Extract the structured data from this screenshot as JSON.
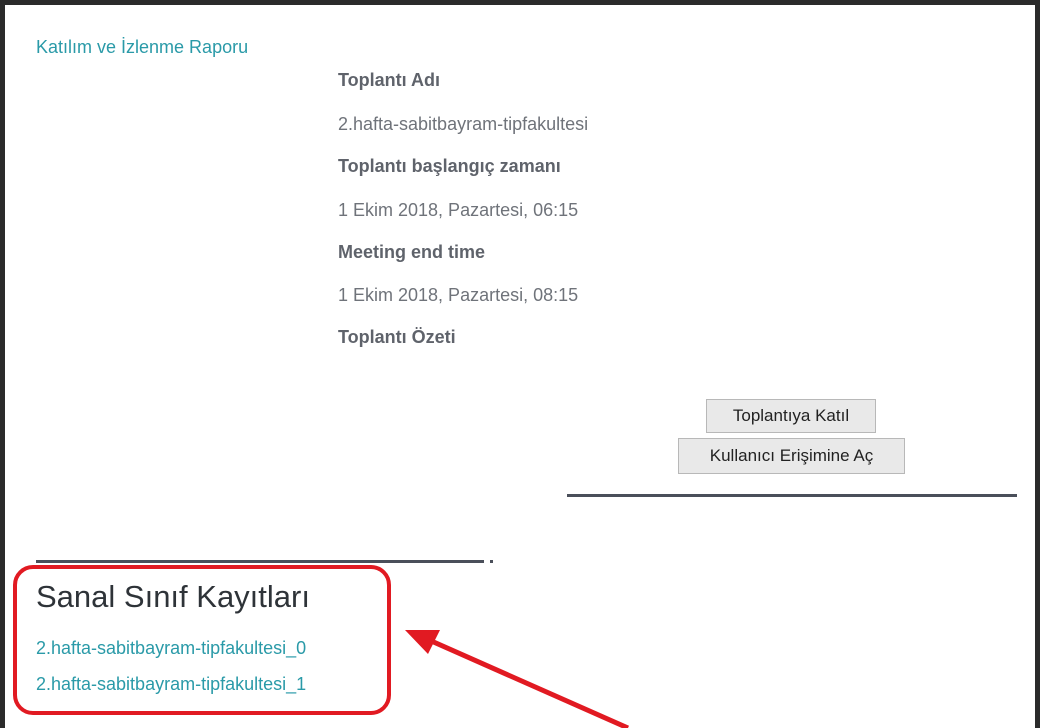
{
  "report_link": "Katılım ve İzlenme Raporu",
  "meeting": {
    "name_label": "Toplantı Adı",
    "name_value": "2.hafta-sabitbayram-tipfakultesi",
    "start_label": "Toplantı başlangıç zamanı",
    "start_value": "1 Ekim 2018, Pazartesi, 06:15",
    "end_label": "Meeting end time",
    "end_value": "1 Ekim 2018, Pazartesi, 08:15",
    "summary_label": "Toplantı Özeti"
  },
  "buttons": {
    "join": "Toplantıya Katıl",
    "open_access": "Kullanıcı Erişimine Aç"
  },
  "recordings": {
    "title": "Sanal Sınıf Kayıtları",
    "items": [
      "2.hafta-sabitbayram-tipfakultesi_0",
      "2.hafta-sabitbayram-tipfakultesi_1"
    ]
  },
  "colors": {
    "link": "#2a9aa8",
    "highlight": "#e11a22",
    "label": "#5f636b"
  }
}
